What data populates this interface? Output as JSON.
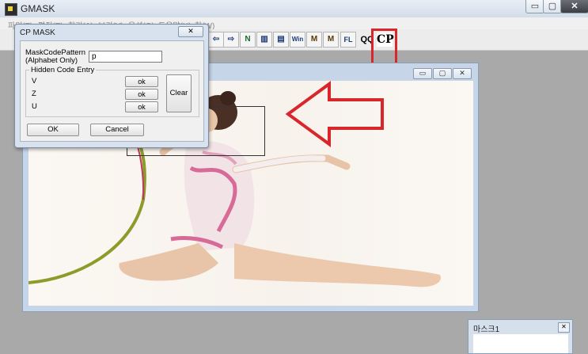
{
  "app": {
    "title": "GMASK"
  },
  "window_buttons": {
    "minimize": "▭",
    "maximize": "▢",
    "close": "✕"
  },
  "menu": {
    "items": [
      {
        "label": "파일(F)"
      },
      {
        "label": "편집(E)"
      },
      {
        "label": "찾기(A)"
      },
      {
        "label": "보기(V)"
      },
      {
        "label": "옵션(O)"
      },
      {
        "label": "도움말(H)"
      },
      {
        "label": "창(W)"
      }
    ]
  },
  "toolbar": {
    "buttons": [
      {
        "icon": "arrow-left-icon",
        "glyph": "⇦"
      },
      {
        "icon": "arrow-right-icon",
        "glyph": "⇨"
      },
      {
        "icon": "n-icon",
        "glyph": "N"
      },
      {
        "icon": "stripes-vertical-icon",
        "glyph": "▥"
      },
      {
        "icon": "stripes-horizontal-icon",
        "glyph": "▤"
      },
      {
        "icon": "win-icon",
        "glyph": "Win"
      },
      {
        "icon": "m-icon",
        "glyph": "M"
      },
      {
        "icon": "m-star-icon",
        "glyph": "M"
      },
      {
        "icon": "fl-icon",
        "glyph": "FL"
      }
    ],
    "qq_label": "QQ",
    "cp_label": "CP"
  },
  "dialog": {
    "title": "CP MASK",
    "close": "✕",
    "mask_pattern_label_1": "MaskCodePattern",
    "mask_pattern_label_2": "(Alphabet Only)",
    "mask_pattern_value": "p",
    "group_label": "Hidden Code Entry",
    "codes": [
      {
        "letter": "V",
        "button": "ok"
      },
      {
        "letter": "Z",
        "button": "ok"
      },
      {
        "letter": "U",
        "button": "ok"
      }
    ],
    "clear_label": "Clear",
    "ok_label": "OK",
    "cancel_label": "Cancel"
  },
  "image_window": {
    "buttons": [
      "▭",
      "▢",
      "✕"
    ]
  },
  "second_window": {
    "title": "마스크1",
    "close": "✕"
  },
  "colors": {
    "highlight": "#d9262b",
    "arrow": "#d9262b"
  }
}
